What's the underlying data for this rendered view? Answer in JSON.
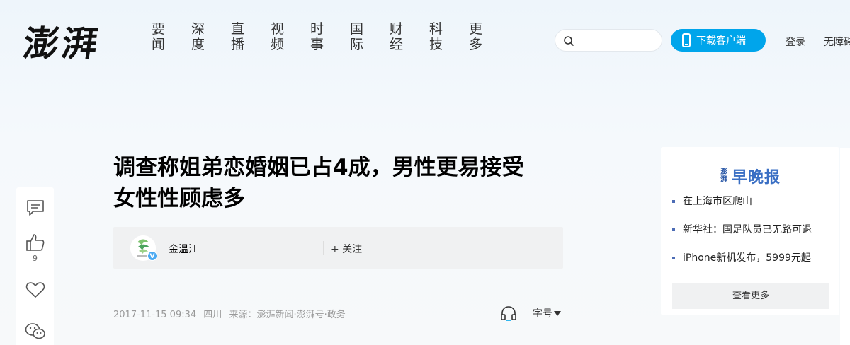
{
  "header": {
    "logo": "澎湃",
    "nav": [
      {
        "top": "要",
        "bottom": "闻"
      },
      {
        "top": "深",
        "bottom": "度"
      },
      {
        "top": "直",
        "bottom": "播"
      },
      {
        "top": "视",
        "bottom": "频"
      },
      {
        "top": "时",
        "bottom": "事"
      },
      {
        "top": "国",
        "bottom": "际"
      },
      {
        "top": "财",
        "bottom": "经"
      },
      {
        "top": "科",
        "bottom": "技"
      },
      {
        "top": "更",
        "bottom": "多"
      }
    ],
    "search_placeholder": "",
    "download_label": "下载客户端",
    "login_label": "登录",
    "accessibility_label": "无障碍"
  },
  "sidebar": {
    "like_count": "9"
  },
  "article": {
    "title_line1": "调查称姐弟恋婚姻已占4成，男性更易接受",
    "title_line2": "女性性顾虑多",
    "author_name": "金温江",
    "follow_label": "+ 关注",
    "date": "2017-11-15 09:34",
    "location": "四川",
    "source": "来源：澎湃新闻·澎湃号·政务",
    "font_size_label": "字号"
  },
  "news_card": {
    "logo_small": "澎湃",
    "logo_main": "早晚报",
    "items": [
      "在上海市区爬山",
      "新华社：国足队员已无路可退",
      "iPhone新机发布，5999元起"
    ],
    "more_label": "查看更多"
  },
  "colors": {
    "accent": "#00a5eb",
    "card_logo": "#3a6fc4"
  }
}
